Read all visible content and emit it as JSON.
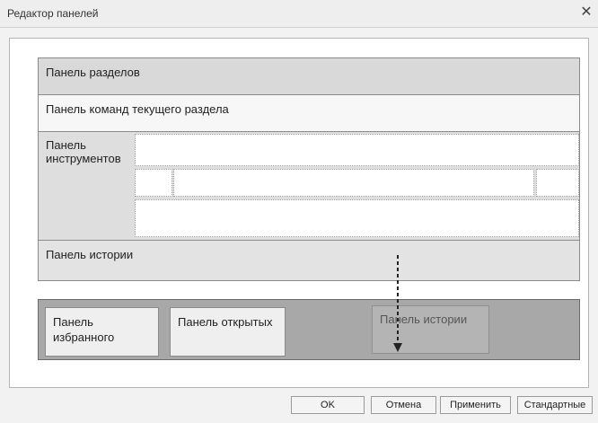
{
  "window": {
    "title": "Редактор панелей",
    "close_glyph": "✕"
  },
  "panels": {
    "sections": "Панель разделов",
    "commands": "Панель команд текущего раздела",
    "tools": "Панель\nинструментов",
    "history": "Панель истории"
  },
  "bottom_area": {
    "favorites": "Панель\nизбранного",
    "open": "Панель открытых",
    "history_ghost": "Панель истории"
  },
  "buttons": {
    "ok": "OK",
    "cancel": "Отмена",
    "apply": "Применить",
    "default": "Стандартные"
  },
  "icons": {
    "close": "close-icon",
    "arrow": "drag-arrow-icon"
  }
}
